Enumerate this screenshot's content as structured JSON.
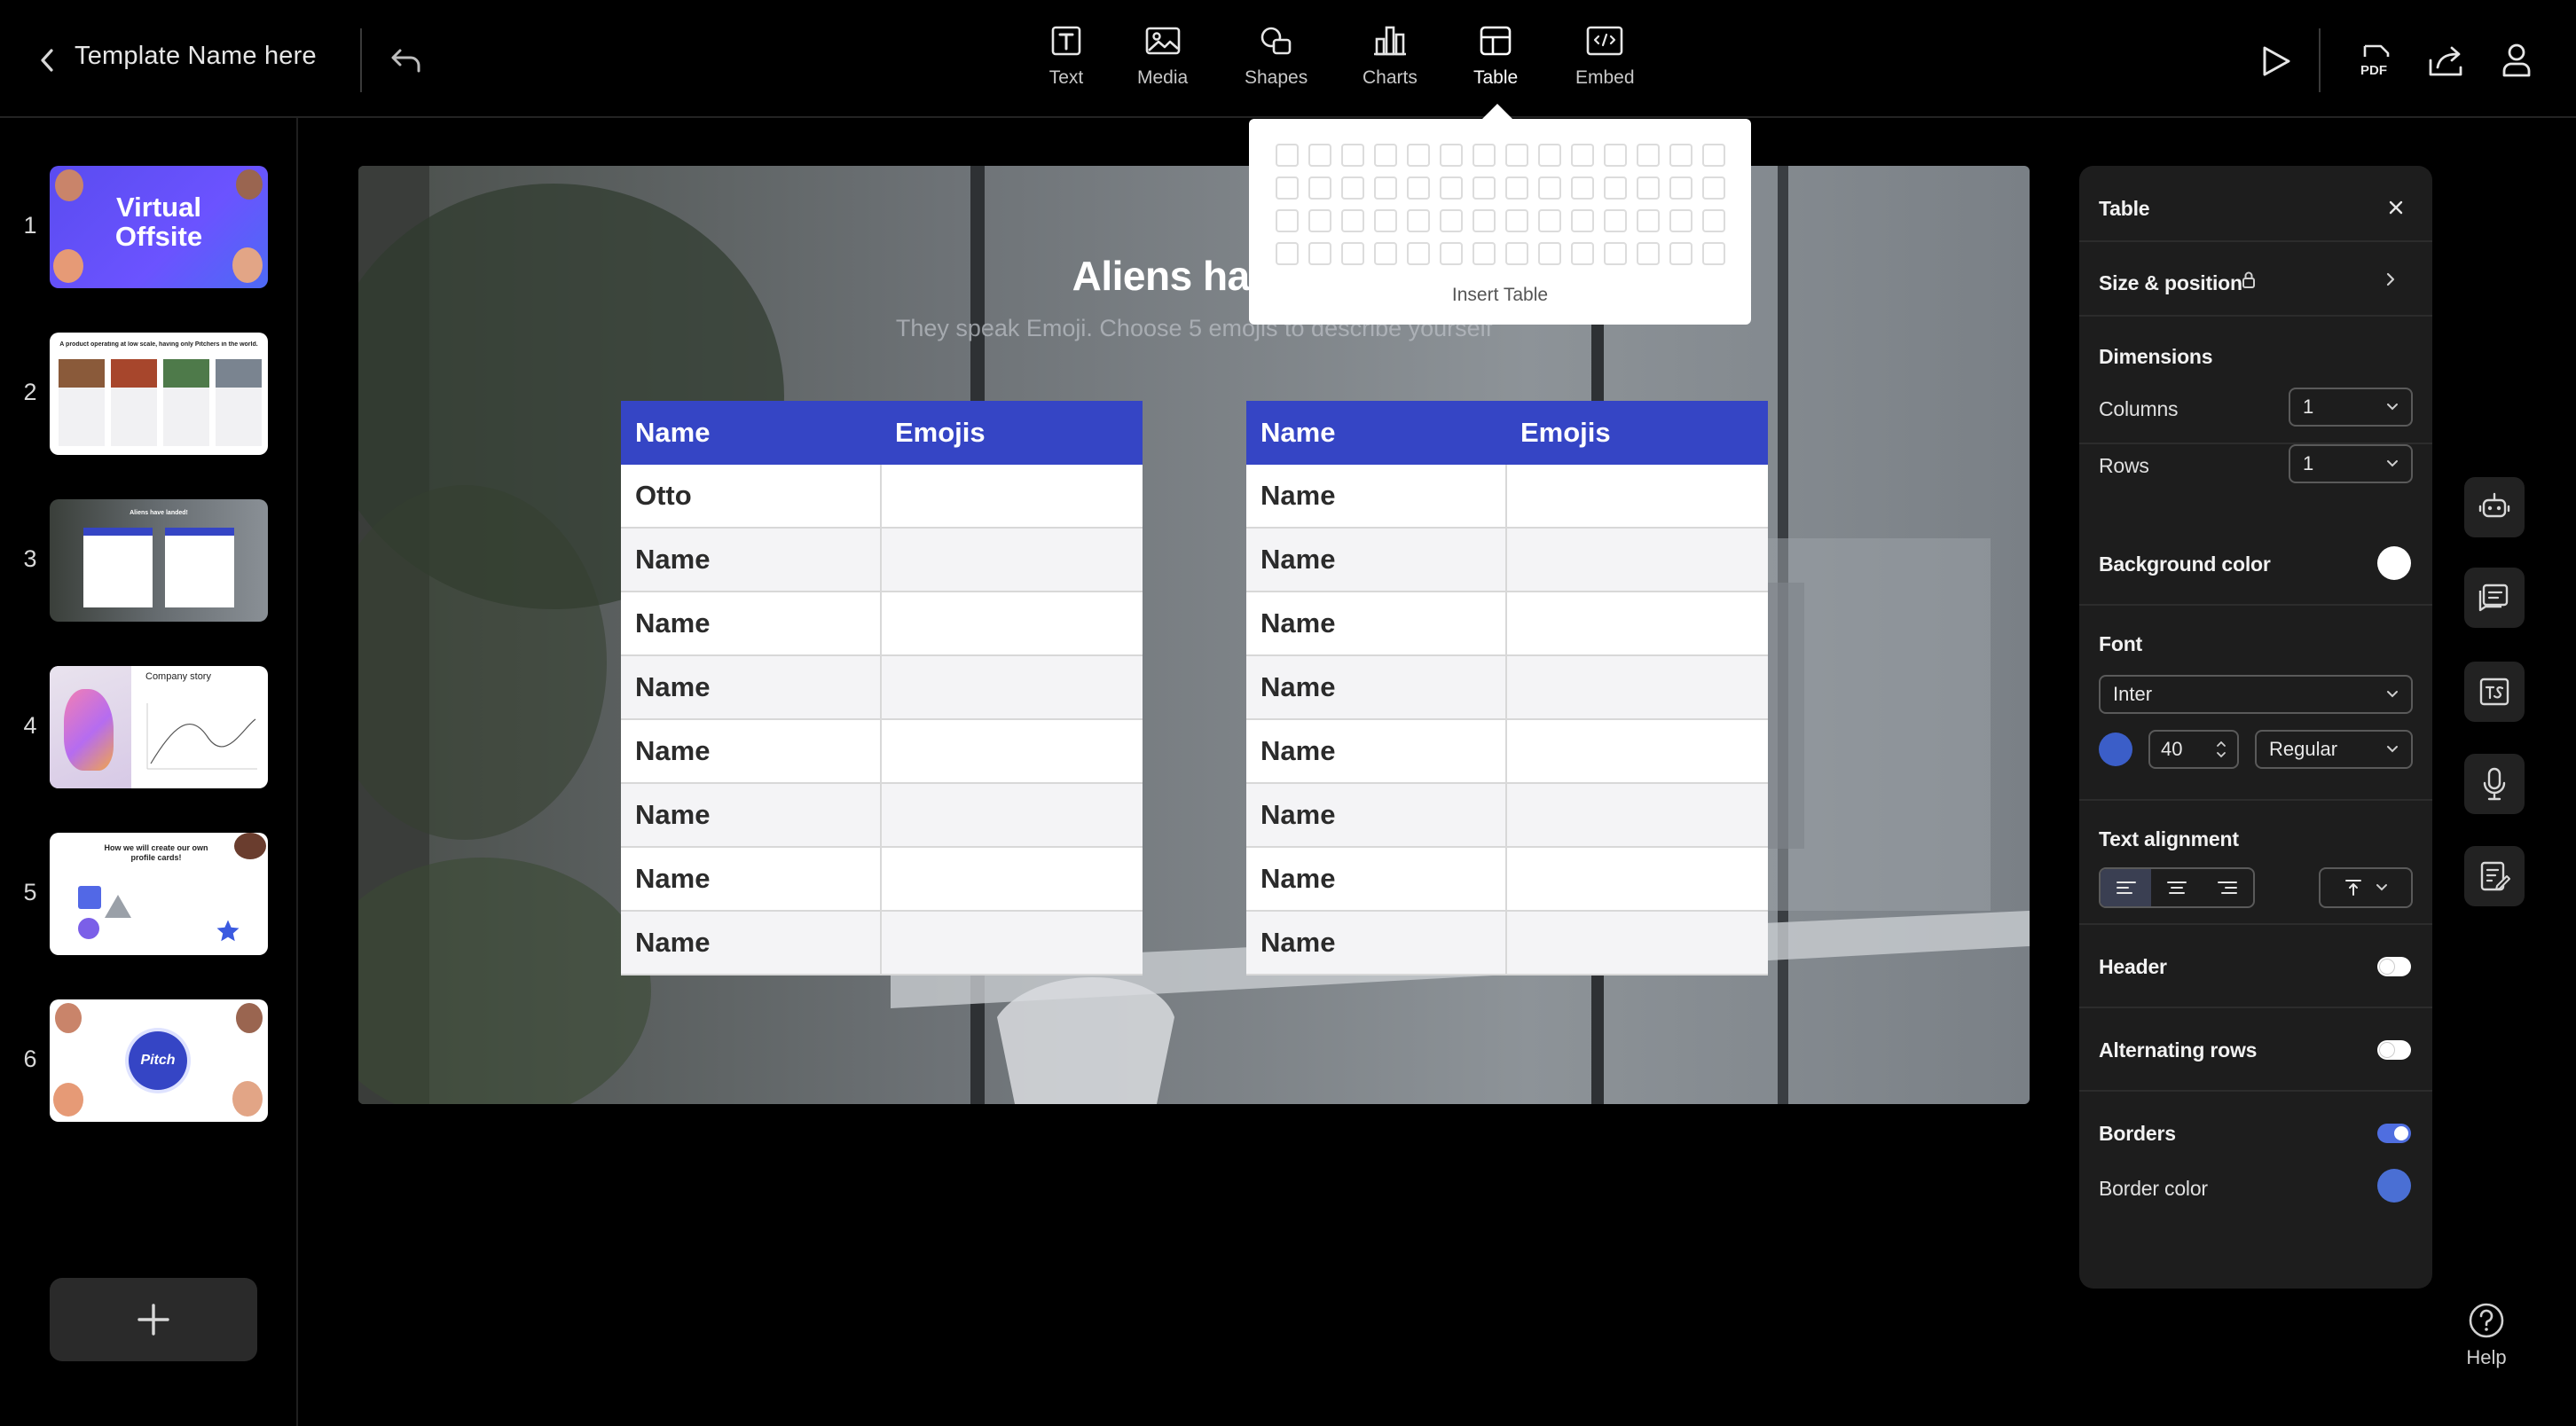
{
  "topbar": {
    "title": "Template Name here",
    "tools": [
      {
        "label": "Text",
        "icon": "text-icon"
      },
      {
        "label": "Media",
        "icon": "image-icon"
      },
      {
        "label": "Shapes",
        "icon": "shapes-icon"
      },
      {
        "label": "Charts",
        "icon": "chart-icon"
      },
      {
        "label": "Table",
        "icon": "table-icon",
        "active": true
      },
      {
        "label": "Embed",
        "icon": "embed-icon"
      }
    ],
    "pdf_label": "PDF"
  },
  "sidebar": {
    "slides": [
      {
        "number": "1",
        "line1": "Virtual",
        "line2": "Offsite"
      },
      {
        "number": "2",
        "heading": "A product operating at low scale, having only Pitchers in the world."
      },
      {
        "number": "3",
        "heading": "Aliens have landed!"
      },
      {
        "number": "4",
        "heading": "Company story"
      },
      {
        "number": "5",
        "heading": "How we will create our own profile cards!"
      },
      {
        "number": "6",
        "heading": "Pitch"
      }
    ]
  },
  "slide": {
    "title": "Aliens have l",
    "subtitle": "They speak Emoji. Choose 5 emojis to describe yourself",
    "tables": [
      {
        "headers": [
          "Name",
          "Emojis"
        ],
        "rows": [
          [
            "Otto",
            ""
          ],
          [
            "Name",
            ""
          ],
          [
            "Name",
            ""
          ],
          [
            "Name",
            ""
          ],
          [
            "Name",
            ""
          ],
          [
            "Name",
            ""
          ],
          [
            "Name",
            ""
          ],
          [
            "Name",
            ""
          ]
        ]
      },
      {
        "headers": [
          "Name",
          "Emojis"
        ],
        "rows": [
          [
            "Name",
            ""
          ],
          [
            "Name",
            ""
          ],
          [
            "Name",
            ""
          ],
          [
            "Name",
            ""
          ],
          [
            "Name",
            ""
          ],
          [
            "Name",
            ""
          ],
          [
            "Name",
            ""
          ],
          [
            "Name",
            ""
          ]
        ]
      }
    ]
  },
  "insert_table": {
    "label": "Insert Table",
    "grid_columns": 14,
    "grid_rows": 4
  },
  "panel": {
    "title": "Table",
    "size_position": "Size & position",
    "dimensions": {
      "title": "Dimensions",
      "columns_label": "Columns",
      "columns_value": "1",
      "rows_label": "Rows",
      "rows_value": "1"
    },
    "background": {
      "label": "Background color",
      "color": "#ffffff"
    },
    "font": {
      "title": "Font",
      "family": "Inter",
      "size": "40",
      "weight": "Regular",
      "color": "#3b5ec8"
    },
    "text_alignment": {
      "title": "Text alignment"
    },
    "header": {
      "label": "Header",
      "on": false
    },
    "alternating_rows": {
      "label": "Alternating rows",
      "on": false
    },
    "borders": {
      "label": "Borders",
      "on": true,
      "color_label": "Border color",
      "color": "#4a6fd4"
    }
  },
  "colors": {
    "accent": "#3545c5",
    "toggle_on": "#4f6ee0"
  },
  "help": {
    "label": "Help"
  }
}
